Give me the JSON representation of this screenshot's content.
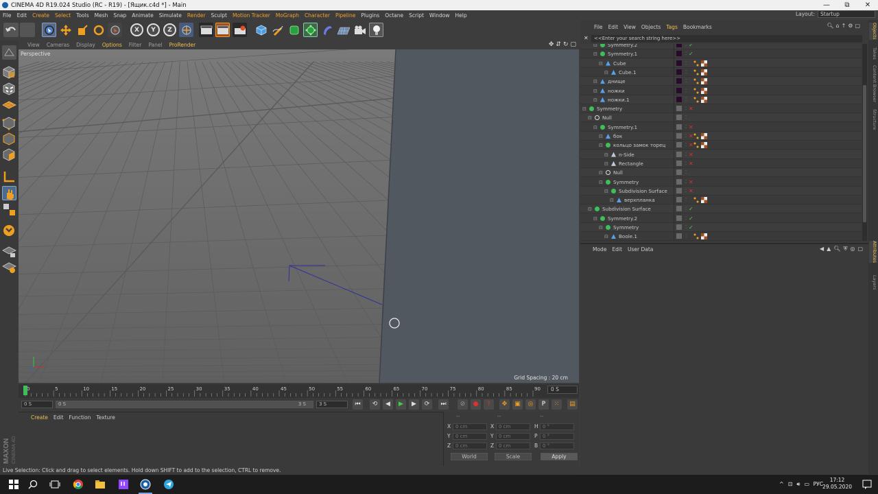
{
  "window": {
    "title": "CINEMA 4D R19.024 Studio (RC - R19) - [Ящик.c4d *] - Main",
    "controls": {
      "minimize": "—",
      "maximize": "⧉",
      "close": "✕"
    }
  },
  "menu": {
    "items": [
      "File",
      "Edit",
      "Create",
      "Select",
      "Tools",
      "Mesh",
      "Snap",
      "Animate",
      "Simulate",
      "Render",
      "Sculpt",
      "Motion Tracker",
      "MoGraph",
      "Character",
      "Pipeline",
      "Plugins",
      "Octane",
      "Script",
      "Window",
      "Help"
    ],
    "highlighted": [
      "Create",
      "Select",
      "Render",
      "Motion Tracker",
      "MoGraph",
      "Character",
      "Pipeline"
    ],
    "layout_label": "Layout:",
    "layout_value": "Startup"
  },
  "toolbar": {
    "axis_x": "X",
    "axis_y": "Y",
    "axis_z": "Z"
  },
  "viewport": {
    "menu": [
      "View",
      "Cameras",
      "Display",
      "Options",
      "Filter",
      "Panel",
      "ProRender"
    ],
    "highlighted": [
      "Options",
      "ProRender"
    ],
    "label": "Perspective",
    "grid_spacing": "Grid Spacing : 20 cm"
  },
  "timeline": {
    "ticks": [
      "0",
      "5",
      "10",
      "15",
      "20",
      "25",
      "30",
      "35",
      "40",
      "45",
      "50",
      "55",
      "60",
      "65",
      "70",
      "75",
      "80",
      "85",
      "90"
    ],
    "current_frame": "0 S"
  },
  "transport": {
    "start_field": "0 S",
    "range_start": "0 S",
    "range_end": "3 S",
    "end_field": "3 S"
  },
  "material": {
    "menu": [
      "Create",
      "Edit",
      "Function",
      "Texture"
    ],
    "highlighted": [
      "Create"
    ]
  },
  "coords": {
    "header": [
      "--",
      "--",
      "--"
    ],
    "rows": [
      {
        "a": "X",
        "av": "0 cm",
        "b": "X",
        "bv": "0 cm",
        "c": "H",
        "cv": "0 °"
      },
      {
        "a": "Y",
        "av": "0 cm",
        "b": "Y",
        "bv": "0 cm",
        "c": "P",
        "cv": "0 °"
      },
      {
        "a": "Z",
        "av": "0 cm",
        "b": "Z",
        "bv": "0 cm",
        "c": "B",
        "cv": "0 °"
      }
    ],
    "world": "World",
    "scale": "Scale",
    "apply": "Apply"
  },
  "branding": {
    "maxon": "MAXON",
    "product": "CINEMA 4D"
  },
  "status": "Live Selection: Click and drag to select elements. Hold down SHIFT to add to the selection, CTRL to remove.",
  "object_manager": {
    "menu": [
      "File",
      "Edit",
      "View",
      "Objects",
      "Tags",
      "Bookmarks"
    ],
    "highlighted": [
      "Tags"
    ],
    "search_placeholder": "<<Enter your search string here>>",
    "rows": [
      {
        "name": "Symmetry.2",
        "indent": 3,
        "kind": "sym",
        "check": "✓",
        "tags": false,
        "dark": true
      },
      {
        "name": "Symmetry.1",
        "indent": 3,
        "kind": "sym",
        "check": "✓",
        "tags": false,
        "dark": true
      },
      {
        "name": "Cube",
        "indent": 4,
        "kind": "poly",
        "check": "",
        "tags": true,
        "dark": true
      },
      {
        "name": "Cube.1",
        "indent": 5,
        "kind": "poly",
        "check": "",
        "tags": true,
        "dark": true
      },
      {
        "name": "днище",
        "indent": 3,
        "kind": "poly",
        "check": "",
        "tags": true,
        "dark": true
      },
      {
        "name": "ножки",
        "indent": 3,
        "kind": "poly",
        "check": "",
        "tags": true,
        "dark": true
      },
      {
        "name": "ножки.1",
        "indent": 3,
        "kind": "poly",
        "check": "",
        "tags": true,
        "dark": true
      },
      {
        "name": "Symmetry",
        "indent": 1,
        "kind": "sym",
        "check": "✕",
        "tags": false,
        "dark": false
      },
      {
        "name": "Null",
        "indent": 2,
        "kind": "null",
        "check": "",
        "tags": false,
        "dark": false
      },
      {
        "name": "Symmetry.1",
        "indent": 3,
        "kind": "sym",
        "check": "✕",
        "tags": false,
        "dark": false
      },
      {
        "name": "бок",
        "indent": 4,
        "kind": "poly",
        "check": "✕",
        "tags": true,
        "dark": false
      },
      {
        "name": "кольцо замок торец",
        "indent": 4,
        "kind": "sweep",
        "check": "✕",
        "tags": true,
        "dark": false
      },
      {
        "name": "n-Side",
        "indent": 5,
        "kind": "spline",
        "check": "✕",
        "tags": false,
        "dark": false
      },
      {
        "name": "Rectangle",
        "indent": 5,
        "kind": "spline",
        "check": "✕",
        "tags": false,
        "dark": false
      },
      {
        "name": "Null",
        "indent": 4,
        "kind": "null",
        "check": "",
        "tags": false,
        "dark": false
      },
      {
        "name": "Symmetry",
        "indent": 4,
        "kind": "sym",
        "check": "✕",
        "tags": false,
        "dark": false
      },
      {
        "name": "Subdivision Surface",
        "indent": 5,
        "kind": "sds",
        "check": "✕",
        "tags": false,
        "dark": false
      },
      {
        "name": "верхпланка",
        "indent": 6,
        "kind": "poly",
        "check": "",
        "tags": true,
        "dark": false
      },
      {
        "name": "Subdivision Surface",
        "indent": 2,
        "kind": "sds",
        "check": "✓",
        "tags": false,
        "dark": false
      },
      {
        "name": "Symmetry.2",
        "indent": 3,
        "kind": "sym",
        "check": "✓",
        "tags": false,
        "dark": false
      },
      {
        "name": "Symmetry",
        "indent": 4,
        "kind": "sym",
        "check": "✓",
        "tags": false,
        "dark": false
      },
      {
        "name": "Boole.1",
        "indent": 5,
        "kind": "poly",
        "check": "",
        "tags": true,
        "dark": false
      }
    ]
  },
  "attribute_manager": {
    "menu": [
      "Mode",
      "Edit",
      "User Data"
    ]
  },
  "right_tabs": [
    {
      "label": "Objects",
      "hl": true
    },
    {
      "label": "Takes",
      "hl": false
    },
    {
      "label": "Content Browser",
      "hl": false
    },
    {
      "label": "Structure",
      "hl": false
    },
    {
      "label": "Attributes",
      "hl": true
    },
    {
      "label": "Layers",
      "hl": false
    }
  ],
  "taskbar": {
    "lang": "РУС",
    "time": "17:12",
    "date": "29.05.2020"
  },
  "colors": {
    "accent": "#f0c050",
    "menu_highlight": "#f0a030",
    "viewport_bg": "#6a6a6a",
    "object_face": "#525860"
  }
}
